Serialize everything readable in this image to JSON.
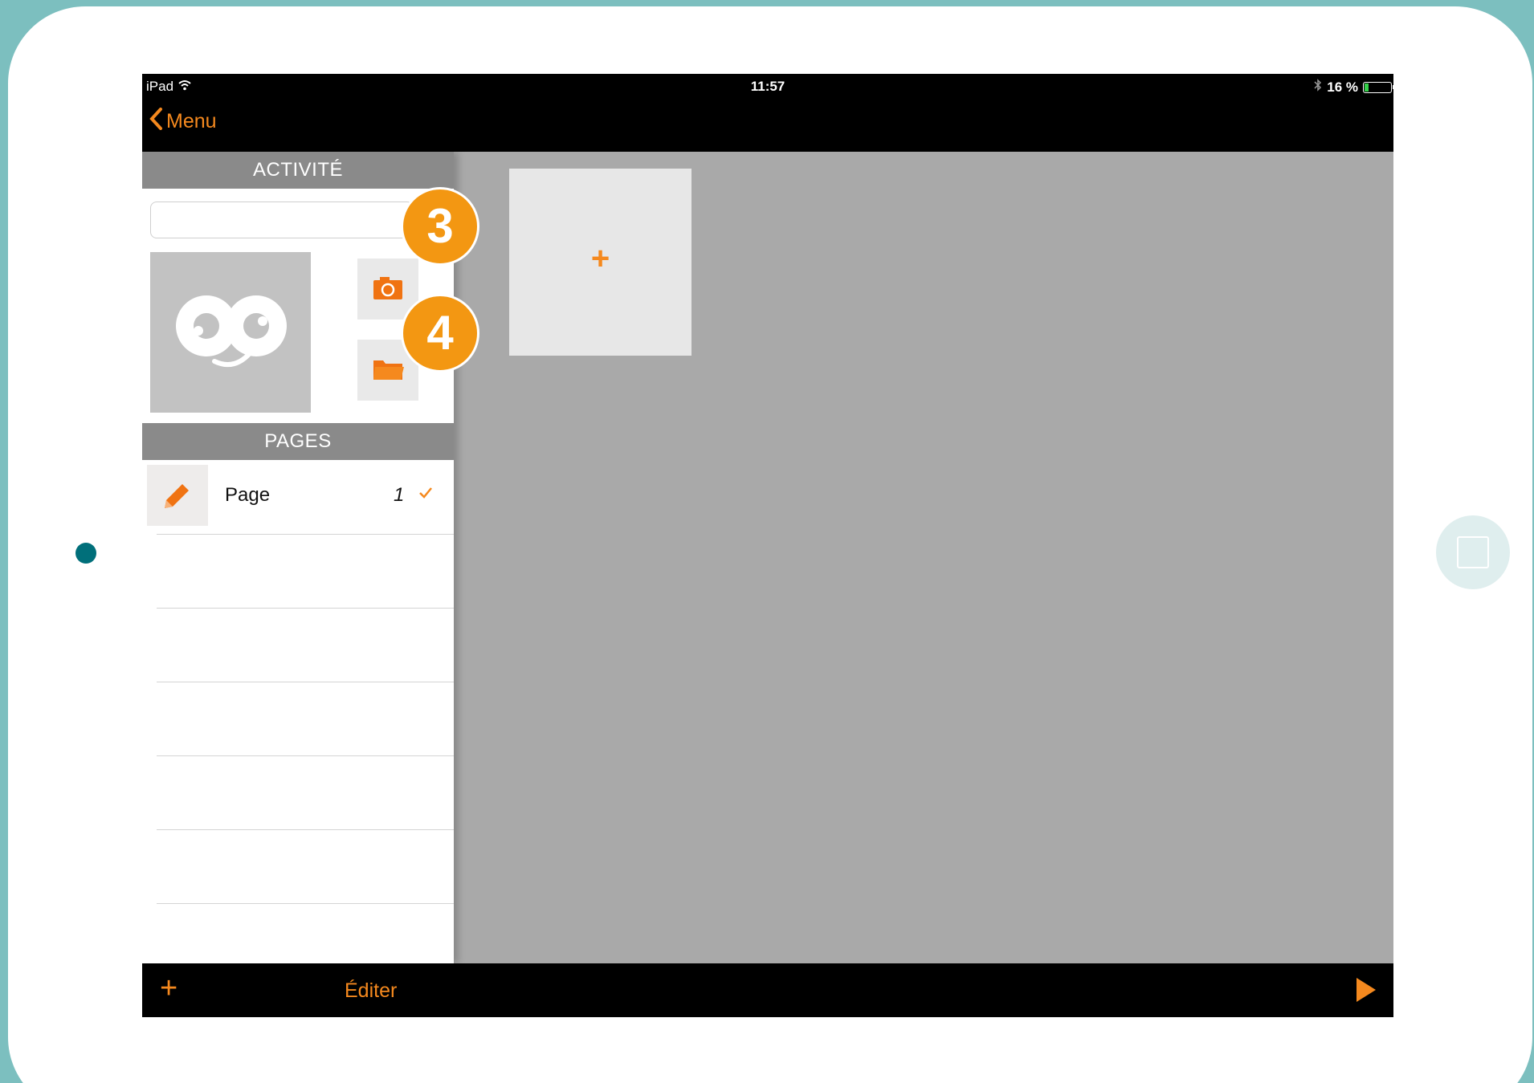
{
  "status_bar": {
    "device": "iPad",
    "time": "11:57",
    "battery": "16 %"
  },
  "nav": {
    "back_label": "Menu"
  },
  "sidebar": {
    "activity_header": "ACTIVITÉ",
    "name_input": {
      "value": "",
      "placeholder": ""
    },
    "pages_header": "PAGES",
    "pages": [
      {
        "label": "Page",
        "number": "1",
        "checked": true
      }
    ]
  },
  "content": {
    "add_tile_symbol": "+"
  },
  "badges": [
    "3",
    "4"
  ],
  "toolbar": {
    "add_symbol": "+",
    "edit_label": "Éditer"
  },
  "colors": {
    "accent": "#f5891e",
    "badge": "#f39712",
    "frame": "#7cbfbf"
  },
  "icons": [
    "wifi-icon",
    "bluetooth-icon",
    "battery-icon",
    "chevron-left-icon",
    "camera-icon",
    "folder-icon",
    "pencil-icon",
    "check-icon",
    "plus-icon",
    "play-icon"
  ]
}
